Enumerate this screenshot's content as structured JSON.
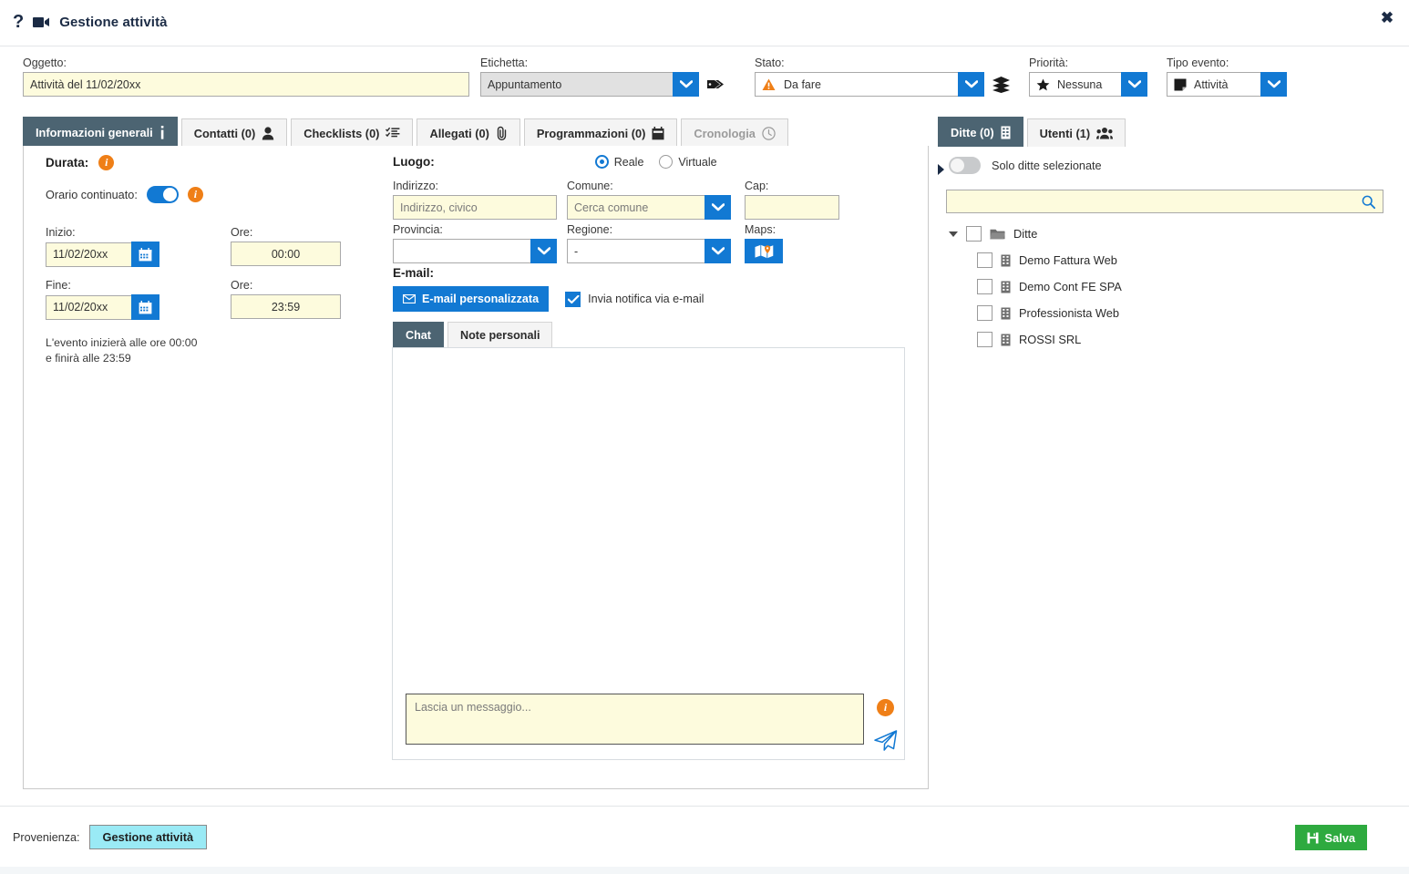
{
  "window": {
    "title": "Gestione attività",
    "help_icon": "question-mark-icon",
    "title_icon": "video-camera-icon",
    "close_label": "✖"
  },
  "colors": {
    "accent_blue": "#1279d3",
    "tab_active": "#4c6472",
    "field_yellow": "#fdfbdd",
    "info_orange": "#ef7f17",
    "save_green": "#2eaa3f",
    "provenance_cyan": "#9aeaf5"
  },
  "topform": {
    "oggetto": {
      "label": "Oggetto:",
      "value": "Attività del 11/02/20xx"
    },
    "etichetta": {
      "label": "Etichetta:",
      "value": "Appuntamento",
      "tag_icon": "tag-icon"
    },
    "stato": {
      "label": "Stato:",
      "value": "Da fare",
      "status_icon": "warning-triangle-icon",
      "layers_icon": "layers-icon"
    },
    "priorita": {
      "label": "Priorità:",
      "value": "Nessuna",
      "icon": "star-icon"
    },
    "tipo_evento": {
      "label": "Tipo evento:",
      "value": "Attività",
      "icon": "note-icon"
    }
  },
  "main_tabs": [
    {
      "label": "Informazioni generali",
      "icon": "info-icon",
      "active": true,
      "disabled": false
    },
    {
      "label": "Contatti (0)",
      "icon": "person-icon",
      "active": false,
      "disabled": false
    },
    {
      "label": "Checklists (0)",
      "icon": "checklist-icon",
      "active": false,
      "disabled": false
    },
    {
      "label": "Allegati (0)",
      "icon": "paperclip-icon",
      "active": false,
      "disabled": false
    },
    {
      "label": "Programmazioni (0)",
      "icon": "calendar-icon",
      "active": false,
      "disabled": false
    },
    {
      "label": "Cronologia",
      "icon": "clock-icon",
      "active": false,
      "disabled": true
    }
  ],
  "durata": {
    "title": "Durata:",
    "orario_continuato_label": "Orario continuato:",
    "orario_continuato_on": true,
    "inizio_label": "Inizio:",
    "inizio_value": "11/02/20xx",
    "inizio_ore_label": "Ore:",
    "inizio_ore_value": "00:00",
    "fine_label": "Fine:",
    "fine_value": "11/02/20xx",
    "fine_ore_label": "Ore:",
    "fine_ore_value": "23:59",
    "hint_line1": "L'evento inizierà alle ore 00:00",
    "hint_line2": "e finirà alle 23:59",
    "calendar_icon": "calendar-icon"
  },
  "luogo": {
    "title": "Luogo:",
    "reale_label": "Reale",
    "virtuale_label": "Virtuale",
    "selected": "Reale",
    "indirizzo_label": "Indirizzo:",
    "indirizzo_placeholder": "Indirizzo, civico",
    "indirizzo_value": "",
    "comune_label": "Comune:",
    "comune_placeholder": "Cerca comune",
    "comune_value": "",
    "cap_label": "Cap:",
    "cap_value": "",
    "provincia_label": "Provincia:",
    "provincia_value": "",
    "regione_label": "Regione:",
    "regione_value": "-",
    "maps_label": "Maps:",
    "maps_icon": "map-icon"
  },
  "email": {
    "title": "E-mail:",
    "custom_button": "E-mail personalizzata",
    "envelope_icon": "envelope-icon",
    "notify_label": "Invia notifica via e-mail",
    "notify_checked": true
  },
  "chat": {
    "tabs": [
      {
        "label": "Chat",
        "active": true
      },
      {
        "label": "Note personali",
        "active": false
      }
    ],
    "messages": [],
    "input_placeholder": "Lascia un messaggio...",
    "input_value": "",
    "send_icon": "paper-plane-icon",
    "info_icon": "info-icon"
  },
  "sidepanel": {
    "tabs": [
      {
        "label": "Ditte (0)",
        "icon": "building-icon",
        "active": true
      },
      {
        "label": "Utenti (1)",
        "icon": "users-icon",
        "active": false
      }
    ],
    "filter_toggle_label": "Solo ditte selezionate",
    "filter_toggle_on": false,
    "search_value": "",
    "search_icon": "search-icon",
    "tree_root": {
      "label": "Ditte",
      "icon": "folder-icon",
      "checked": false,
      "expanded": true
    },
    "tree_items": [
      {
        "label": "Demo Fattura Web",
        "icon": "building-icon",
        "checked": false
      },
      {
        "label": "Demo Cont FE SPA",
        "icon": "building-icon",
        "checked": false
      },
      {
        "label": "Professionista Web",
        "icon": "building-icon",
        "checked": false
      },
      {
        "label": "ROSSI SRL",
        "icon": "building-icon",
        "checked": false
      }
    ]
  },
  "footer": {
    "provenienza_label": "Provenienza:",
    "provenienza_value": "Gestione attività",
    "save_label": "Salva",
    "save_icon": "floppy-disk-icon"
  }
}
